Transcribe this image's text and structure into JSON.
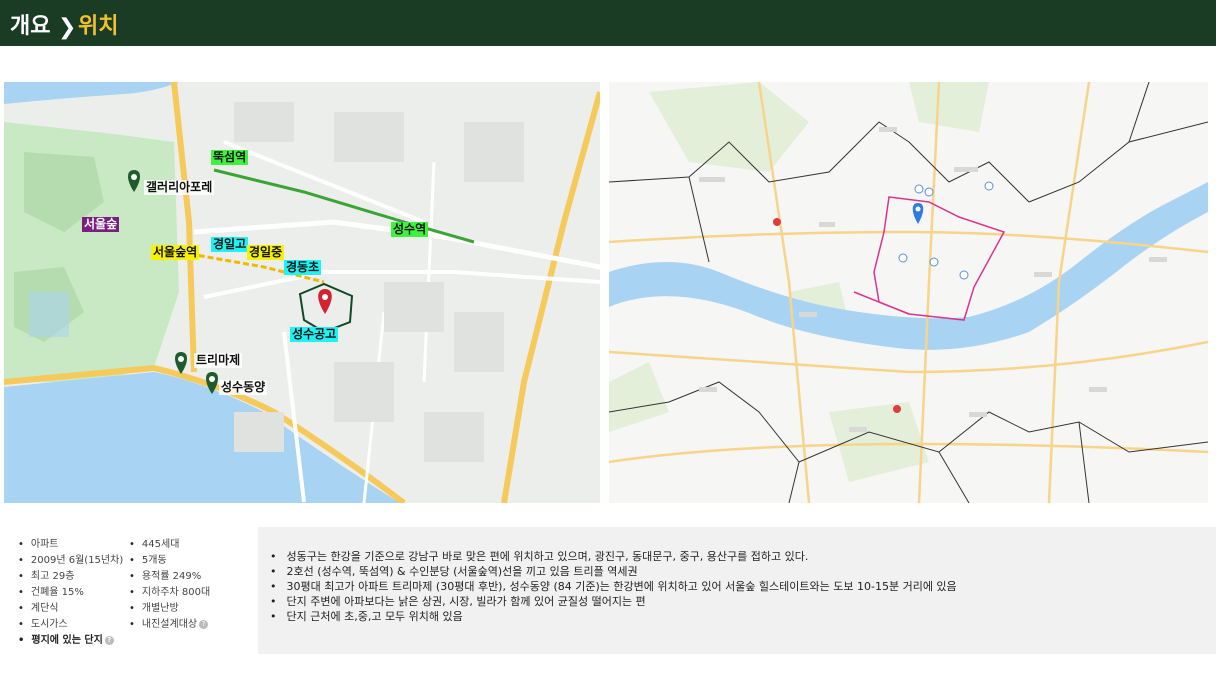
{
  "header": {
    "breadcrumb_parent": "개요",
    "separator": "❯",
    "breadcrumb_current": "위치"
  },
  "map_left": {
    "labels": {
      "ttukseom": "뚝섬역",
      "gallery": "갤러리아포레",
      "seoulforest_park": "서울숲",
      "gyeongil_high": "경일고",
      "gyeongil_mid": "경일중",
      "seoulforest_stn": "서울숲역",
      "gyeongdong": "경동초",
      "seongsu_stn": "성수역",
      "seongsu_tech": "성수공고",
      "trimage": "트리마제",
      "seongsu_dongyang": "성수동양"
    }
  },
  "facts": {
    "col1": [
      "아파트",
      "2009년 6월(15년차)",
      "최고 29층",
      "건폐율 15%",
      "계단식",
      "도시가스",
      "평지에 있는 단지"
    ],
    "col2": [
      "445세대",
      "5개동",
      "용적률 249%",
      "지하주차 800대",
      "개별난방",
      "내진설계대상"
    ],
    "help_icon": "question-icon",
    "help_glyph": "?"
  },
  "description": [
    "성동구는 한강을 기준으로 강남구 바로 맞은 편에 위치하고 있으며, 광진구, 동대문구, 중구, 용산구를 접하고 있다.",
    "2호선 (성수역, 뚝섬역) & 수인분당 (서울숲역)선을 끼고 있음 트리플 역세권",
    "30평대 최고가 아파트 트리마제 (30평대 후반), 성수동양 (84 기준)는 한강변에 위치하고 있어 서울숲 힐스테이트와는 도보 10-15분 거리에 있음",
    "단지 주변에 아파보다는 낡은 상권, 시장, 빌라가 함께 있어 균질성 떨어지는 편",
    "단지 근처에 초,중,고 모두 위치해 있음"
  ],
  "colors": {
    "header_bg": "#1a3c25",
    "accent": "#f2c12e",
    "river": "#a9d3f2",
    "district_border": "#d9358d"
  }
}
